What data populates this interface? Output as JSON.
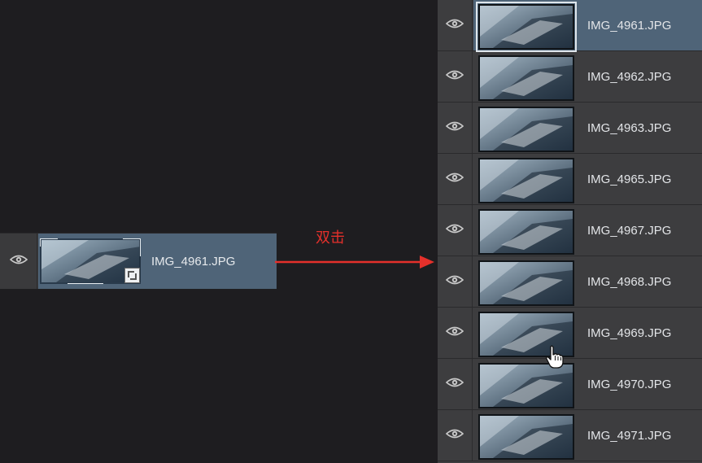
{
  "annotation": {
    "label": "双击"
  },
  "left_layer": {
    "name": "IMG_4961.JPG",
    "selected": true,
    "visible": true,
    "type": "smart-object"
  },
  "layers_panel": {
    "layers": [
      {
        "name": "IMG_4961.JPG",
        "selected": true
      },
      {
        "name": "IMG_4962.JPG",
        "selected": false
      },
      {
        "name": "IMG_4963.JPG",
        "selected": false
      },
      {
        "name": "IMG_4965.JPG",
        "selected": false
      },
      {
        "name": "IMG_4967.JPG",
        "selected": false
      },
      {
        "name": "IMG_4968.JPG",
        "selected": false
      },
      {
        "name": "IMG_4969.JPG",
        "selected": false
      },
      {
        "name": "IMG_4970.JPG",
        "selected": false
      },
      {
        "name": "IMG_4971.JPG",
        "selected": false
      }
    ]
  },
  "icons": {
    "eye": "eye-icon",
    "cursor": "hand-cursor-icon",
    "badge": "smart-object-badge-icon"
  },
  "colors": {
    "selection": "#4f6478",
    "annotation": "#e5302b"
  }
}
